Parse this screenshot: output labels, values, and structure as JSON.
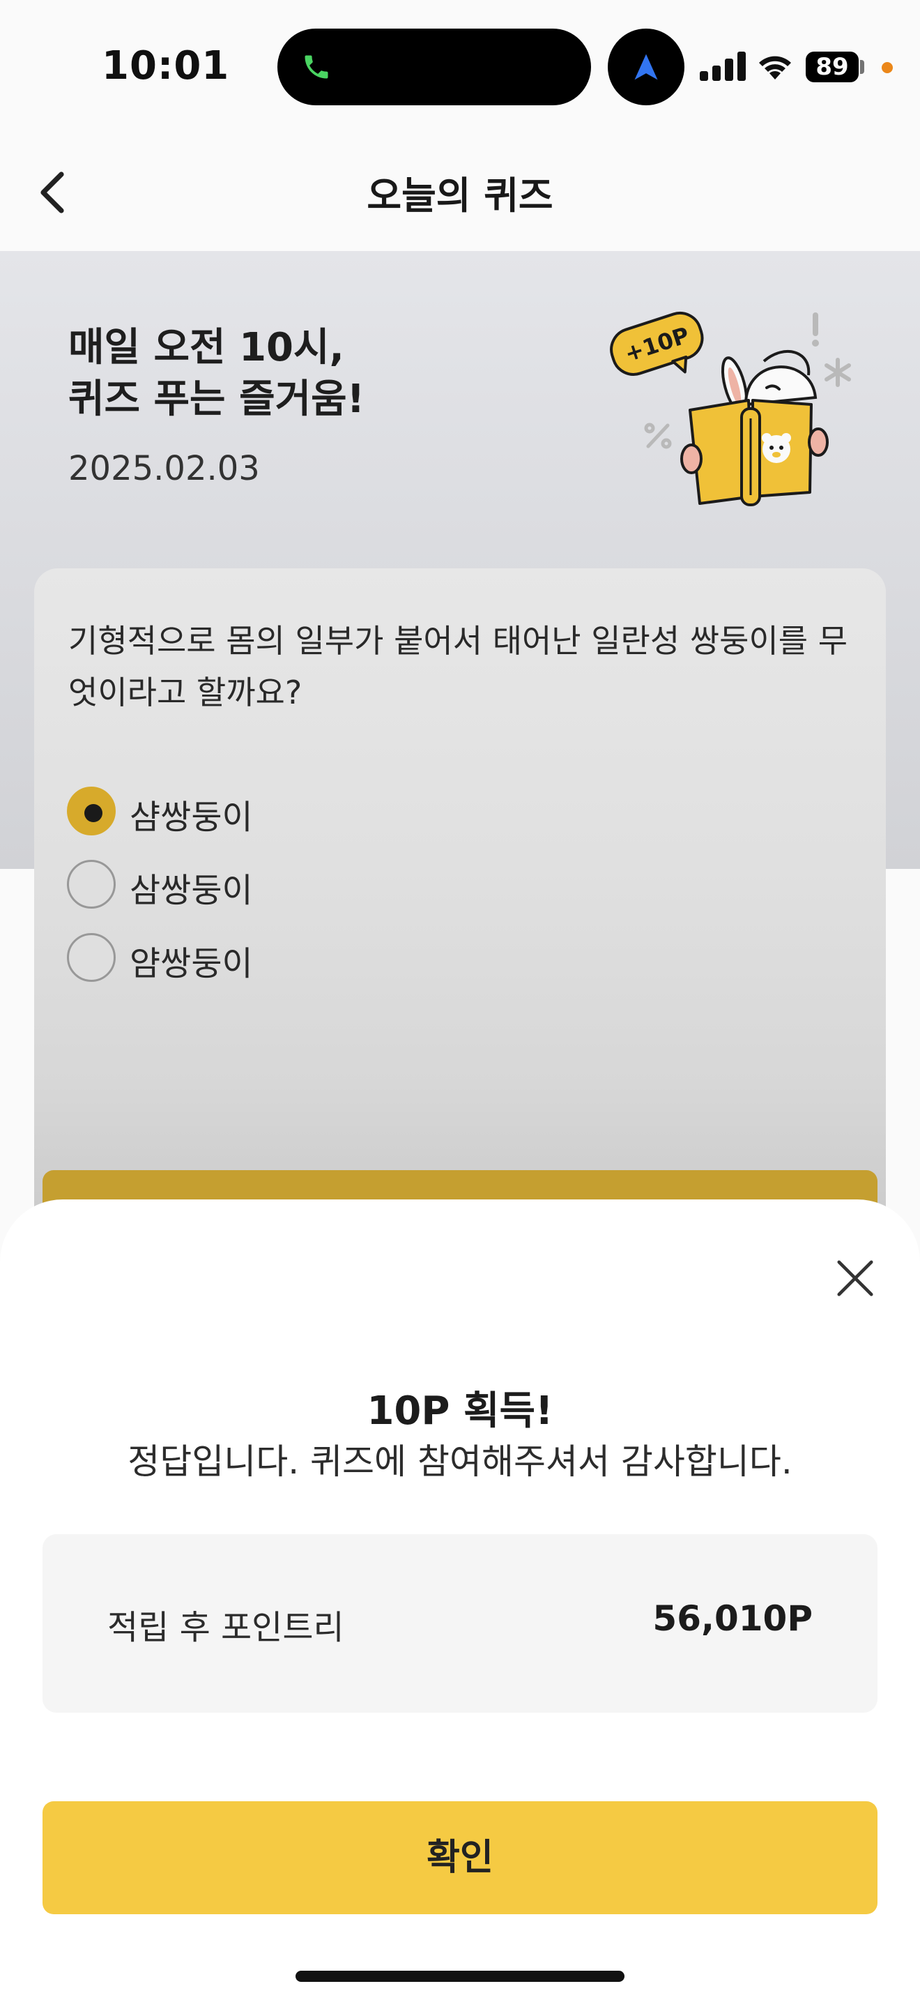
{
  "status_bar": {
    "time": "10:01",
    "battery": "89",
    "icons": [
      "phone-call-icon",
      "navigation-arrow-icon",
      "cellular-signal-icon",
      "wifi-icon",
      "battery-icon"
    ],
    "colors": {
      "call_green": "#4cd964",
      "nav_blue": "#3478f6",
      "privacy_dot": "#f08a1a"
    }
  },
  "header": {
    "title": "오늘의 퀴즈",
    "back_icon": "chevron-left-icon"
  },
  "banner": {
    "headline_line1": "매일 오전 10시,",
    "headline_line2": "퀴즈 푸는 즐거움!",
    "date": "2025.02.03",
    "badge_text": "+10P",
    "illustration": "rabbit-reading-book-illustration"
  },
  "quiz": {
    "question": "기형적으로 몸의 일부가 붙어서 태어난 일란성 쌍둥이를 무엇이라고 할까요?",
    "options": [
      {
        "label": "샴쌍둥이",
        "selected": true
      },
      {
        "label": "삼쌍둥이",
        "selected": false
      },
      {
        "label": "얌쌍둥이",
        "selected": false
      }
    ]
  },
  "result_sheet": {
    "close_icon": "close-icon",
    "title": "10P 획득!",
    "message": "정답입니다. 퀴즈에 참여해주셔서 감사합니다.",
    "points_label": "적립 후 포인트리",
    "points_value": "56,010P",
    "confirm_label": "확인"
  },
  "colors": {
    "accent_yellow": "#f5ca43",
    "selected_radio": "#dcae2c",
    "banner_bg": "#e9eaee",
    "points_box_bg": "#f5f5f5"
  }
}
